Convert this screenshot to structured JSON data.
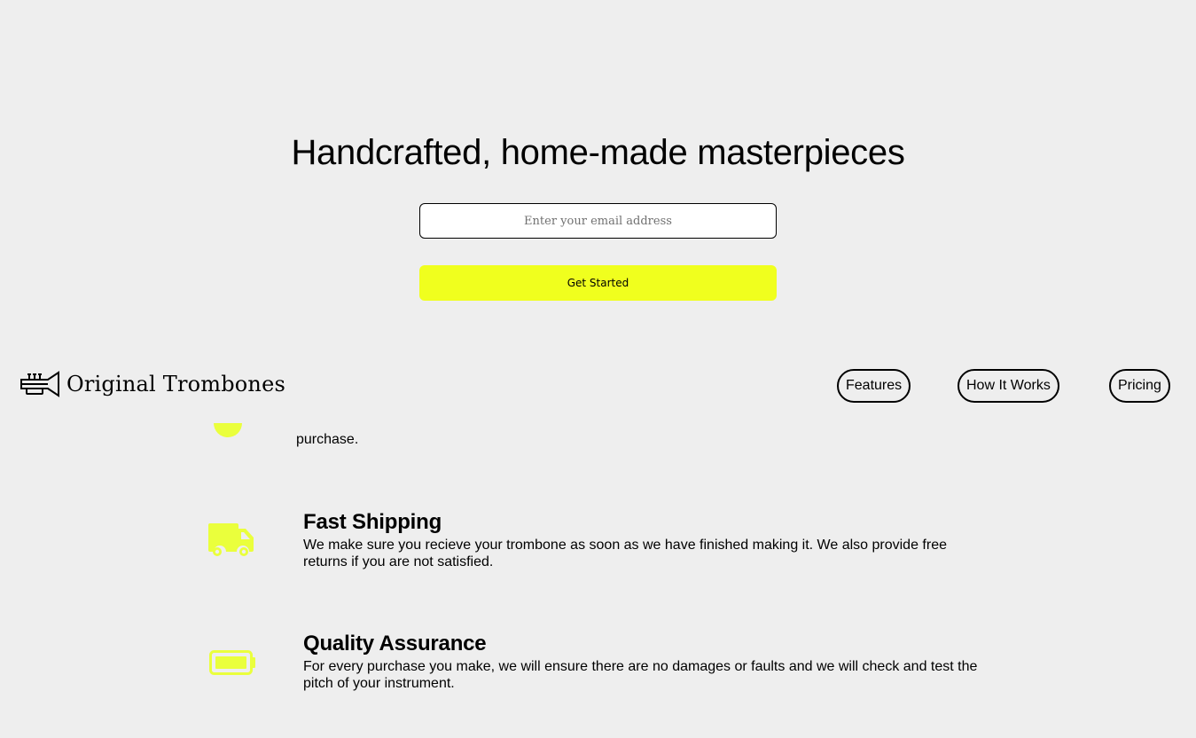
{
  "hero": {
    "title": "Handcrafted, home-made masterpieces",
    "email_placeholder": "Enter your email address",
    "cta_label": "Get Started"
  },
  "header": {
    "logo_text": "Original Trombones",
    "logo_icon": "trumpet-icon",
    "nav": [
      {
        "label": "Features"
      },
      {
        "label": "How It Works"
      },
      {
        "label": "Pricing"
      }
    ]
  },
  "features": {
    "partial_text": "purchase.",
    "items": [
      {
        "icon": "truck-icon",
        "title": "Fast Shipping",
        "description": "We make sure you recieve your trombone as soon as we have finished making it. We also provide free returns if you are not satisfied."
      },
      {
        "icon": "battery-full-icon",
        "title": "Quality Assurance",
        "description": "For every purchase you make, we will ensure there are no damages or faults and we will check and test the pitch of your instrument."
      }
    ]
  },
  "colors": {
    "background": "#eeeeee",
    "accent": "#f0ff1e",
    "icon": "#eaff3c",
    "text": "#000000"
  }
}
